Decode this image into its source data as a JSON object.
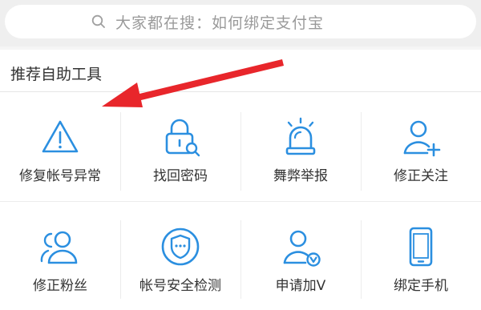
{
  "search": {
    "placeholder": "大家都在搜：如何绑定支付宝",
    "icon": "search-icon"
  },
  "section": {
    "title": "推荐自助工具"
  },
  "tools": [
    {
      "label": "修复帐号异常",
      "icon": "warning-triangle-icon"
    },
    {
      "label": "找回密码",
      "icon": "lock-search-icon"
    },
    {
      "label": "舞弊举报",
      "icon": "alarm-light-icon"
    },
    {
      "label": "修正关注",
      "icon": "user-add-icon"
    },
    {
      "label": "修正粉丝",
      "icon": "user-group-icon"
    },
    {
      "label": "帐号安全检测",
      "icon": "shield-icon"
    },
    {
      "label": "申请加V",
      "icon": "user-verified-icon"
    },
    {
      "label": "绑定手机",
      "icon": "mobile-phone-icon"
    }
  ],
  "colors": {
    "icon": "#2b8fe0",
    "arrow": "#e8262b"
  }
}
